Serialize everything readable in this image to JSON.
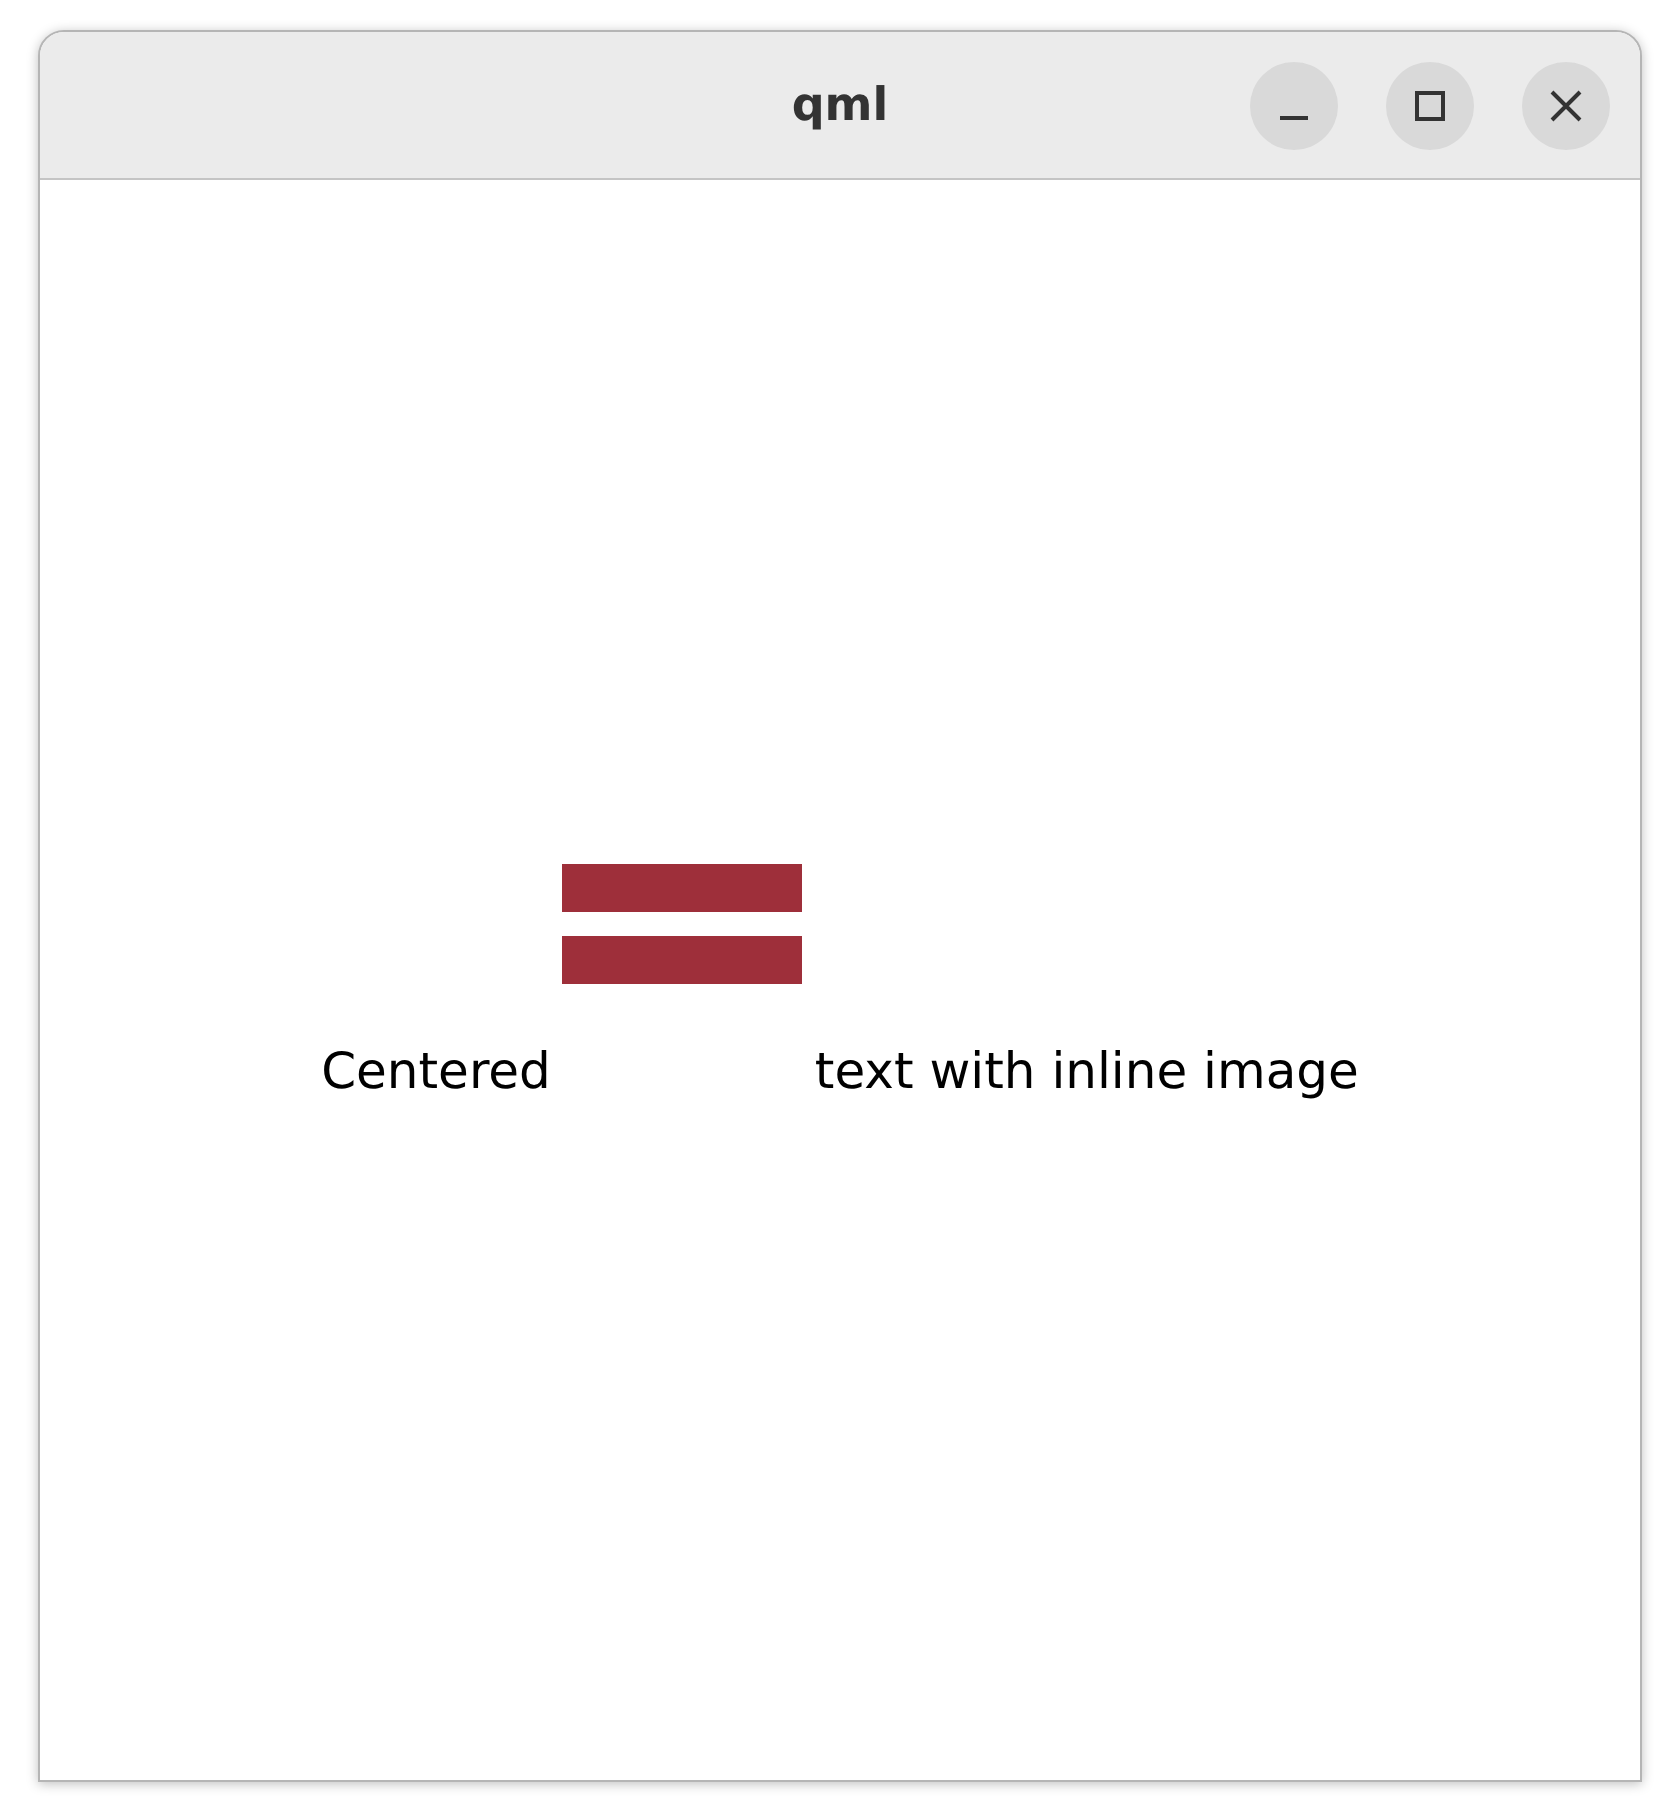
{
  "window": {
    "title": "qml",
    "controls": [
      {
        "kind": "minimize"
      },
      {
        "kind": "maximize"
      },
      {
        "kind": "close"
      }
    ]
  },
  "content": {
    "text_before": "Centered",
    "text_after": "text with inline image"
  }
}
